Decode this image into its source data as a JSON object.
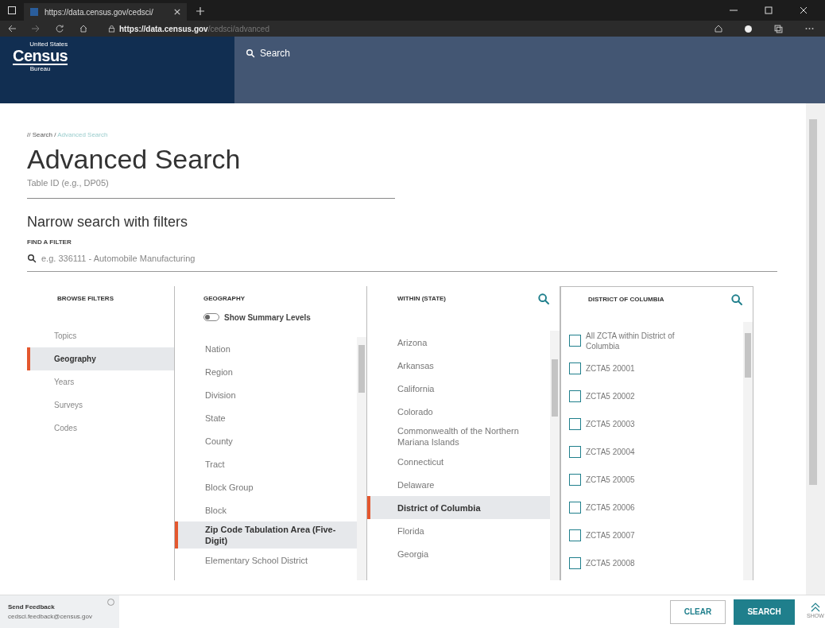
{
  "browser": {
    "tab_title": "https://data.census.gov/cedsci/",
    "url_host": "https://data.census.gov",
    "url_path": "/cedsci/advanced"
  },
  "header": {
    "logo_top": "United States",
    "logo": "Census",
    "logo_bottom": "Bureau",
    "search_label": "Search"
  },
  "breadcrumb": {
    "parent": "// Search /",
    "current": "Advanced Search"
  },
  "title": "Advanced Search",
  "table_id": {
    "placeholder": "Table ID (e.g., DP05)"
  },
  "filters_heading": "Narrow search with filters",
  "find_filter": {
    "label": "FIND A FILTER",
    "placeholder": "e.g. 336111 - Automobile Manufacturing"
  },
  "browse_filters": {
    "heading": "BROWSE FILTERS",
    "items": [
      {
        "label": "Topics",
        "selected": false
      },
      {
        "label": "Geography",
        "selected": true
      },
      {
        "label": "Years",
        "selected": false
      },
      {
        "label": "Surveys",
        "selected": false
      },
      {
        "label": "Codes",
        "selected": false
      }
    ]
  },
  "geography": {
    "heading": "GEOGRAPHY",
    "toggle": {
      "label": "Show Summary Levels",
      "on": false
    },
    "items": [
      {
        "label": "Nation",
        "selected": false
      },
      {
        "label": "Region",
        "selected": false
      },
      {
        "label": "Division",
        "selected": false
      },
      {
        "label": "State",
        "selected": false
      },
      {
        "label": "County",
        "selected": false
      },
      {
        "label": "Tract",
        "selected": false
      },
      {
        "label": "Block Group",
        "selected": false
      },
      {
        "label": "Block",
        "selected": false
      },
      {
        "label": "Zip Code Tabulation Area (Five-Digit)",
        "selected": true
      },
      {
        "label": "Elementary School District",
        "selected": false
      }
    ]
  },
  "within_state": {
    "heading": "WITHIN (STATE)",
    "items": [
      {
        "label": "Arizona",
        "selected": false
      },
      {
        "label": "Arkansas",
        "selected": false
      },
      {
        "label": "California",
        "selected": false
      },
      {
        "label": "Colorado",
        "selected": false
      },
      {
        "label": "Commonwealth of the Northern Mariana Islands",
        "selected": false
      },
      {
        "label": "Connecticut",
        "selected": false
      },
      {
        "label": "Delaware",
        "selected": false
      },
      {
        "label": "District of Columbia",
        "selected": true
      },
      {
        "label": "Florida",
        "selected": false
      },
      {
        "label": "Georgia",
        "selected": false
      }
    ]
  },
  "district": {
    "heading": "DISTRICT OF COLUMBIA",
    "items": [
      {
        "label": "All ZCTA within District of Columbia",
        "checked": false
      },
      {
        "label": "ZCTA5 20001",
        "checked": false
      },
      {
        "label": "ZCTA5 20002",
        "checked": false
      },
      {
        "label": "ZCTA5 20003",
        "checked": false
      },
      {
        "label": "ZCTA5 20004",
        "checked": false
      },
      {
        "label": "ZCTA5 20005",
        "checked": false
      },
      {
        "label": "ZCTA5 20006",
        "checked": false
      },
      {
        "label": "ZCTA5 20007",
        "checked": false
      },
      {
        "label": "ZCTA5 20008",
        "checked": false
      }
    ]
  },
  "feedback": {
    "title": "Send Feedback",
    "email": "cedsci.feedback@census.gov"
  },
  "buttons": {
    "clear": "CLEAR",
    "search": "SEARCH",
    "show": "SHOW"
  }
}
